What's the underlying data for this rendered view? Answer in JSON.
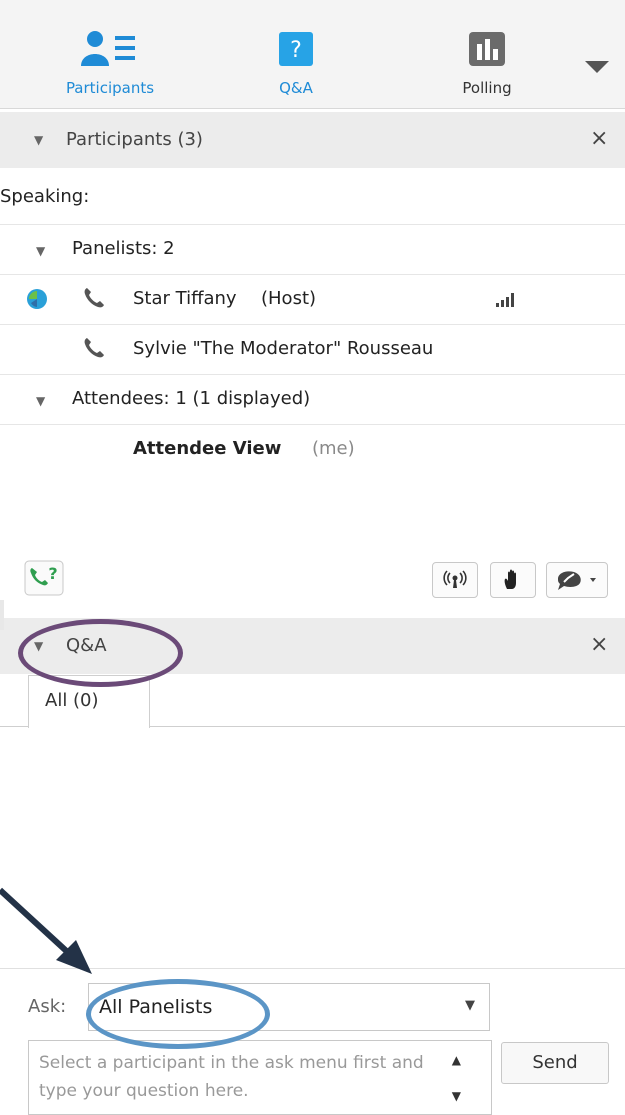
{
  "toolbar": {
    "participants_label": "Participants",
    "qa_label": "Q&A",
    "qa_icon_glyph": "?",
    "polling_label": "Polling",
    "accent_color": "#1f8bd6"
  },
  "participants_panel": {
    "title": "Participants (3)",
    "close": "×",
    "speaking_label": "Speaking:",
    "panelists_header": "Panelists: 2",
    "panelists": [
      {
        "name": "Star Tiffany",
        "role": "(Host)"
      },
      {
        "name": "Sylvie \"The Moderator\" Rousseau",
        "role": ""
      }
    ],
    "attendees_header": "Attendees: 1 (1 displayed)",
    "attendees": [
      {
        "name": "Attendee View",
        "suffix": "(me)"
      }
    ]
  },
  "qa_panel": {
    "title": "Q&A",
    "close": "×",
    "tabs": [
      {
        "label": "All (0)"
      }
    ]
  },
  "ask": {
    "label": "Ask:",
    "selected": "All Panelists",
    "placeholder": "Select a participant in the ask menu first and type your question here.",
    "send_label": "Send"
  },
  "icons": {
    "participants": "participants-icon",
    "qa": "question-icon",
    "polling": "polling-icon",
    "phone": "phone-icon",
    "signal": "signal-strength-icon",
    "raise_hand": "raise-hand-icon"
  },
  "annotations": {
    "purple": "#6b4a78",
    "blue": "#5b95c6",
    "arrow": "#233247"
  }
}
